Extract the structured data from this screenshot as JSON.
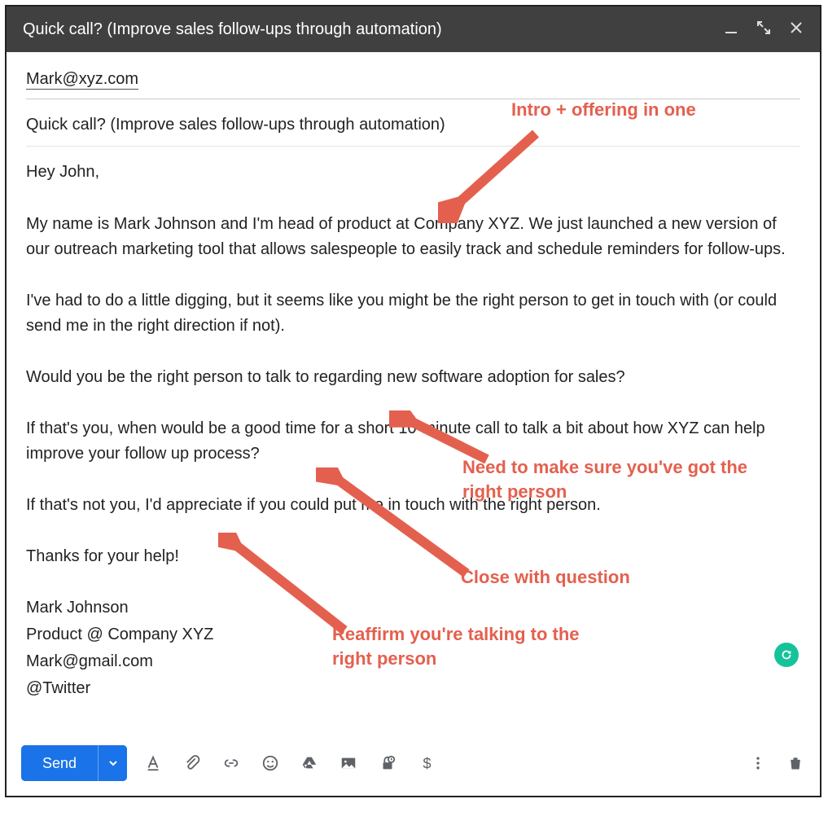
{
  "titlebar": {
    "subject": "Quick call? (Improve sales follow-ups through automation)"
  },
  "compose": {
    "to": "Mark@xyz.com",
    "subject": "Quick call? (Improve sales follow-ups through automation)",
    "body": {
      "greeting": "Hey John,",
      "p1": "My name is Mark Johnson and I'm head of product at Company XYZ. We just launched a new version of our outreach marketing tool that allows salespeople to easily track and schedule reminders for follow-ups.",
      "p2": "I've had to do a little digging, but it seems like you might be the right person to get in touch with (or could send me in the right direction if not).",
      "p3": "Would you be the right person to talk to regarding new software adoption for sales?",
      "p4": "If that's you, when would be a good time for a short 10-minute call to talk a bit about how XYZ can help improve your follow up process?",
      "p5": "If that's not you, I'd appreciate if you could put me in touch with the right person.",
      "p6": "Thanks for your help!",
      "sig_name": "Mark Johnson",
      "sig_title": "Product @ Company XYZ",
      "sig_email": "Mark@gmail.com",
      "sig_twitter": "@Twitter"
    }
  },
  "toolbar": {
    "send_label": "Send"
  },
  "annotations": {
    "a1": "Intro + offering in one",
    "a2": "Need to make sure you've got the right person",
    "a3": "Close with question",
    "a4": "Reaffirm you're talking to the right person"
  },
  "colors": {
    "annotation": "#e4604e",
    "primary": "#1a73e8",
    "grammarly": "#15c39a"
  }
}
